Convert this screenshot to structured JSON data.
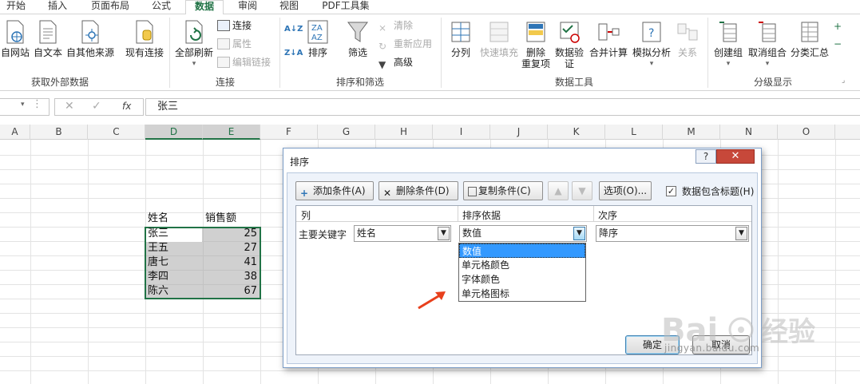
{
  "tabs": [
    "开始",
    "插入",
    "页面布局",
    "公式",
    "数据",
    "审阅",
    "视图",
    "PDF工具集"
  ],
  "active_tab": "数据",
  "ribbon": {
    "get_external": {
      "items": [
        "自网站",
        "自文本",
        "自其他来源",
        "现有连接"
      ],
      "label": "获取外部数据"
    },
    "connections": {
      "refresh_all": "全部刷新",
      "small": [
        "连接",
        "属性",
        "编辑链接"
      ],
      "label": "连接"
    },
    "sort_filter": {
      "sort": "排序",
      "filter": "筛选",
      "small": [
        "清除",
        "重新应用",
        "高级"
      ],
      "label": "排序和筛选"
    },
    "data_tools": {
      "items": [
        "分列",
        "快速填充",
        "删除",
        "重复项",
        "数据验",
        "证",
        "合并计算",
        "模拟分析",
        "关系"
      ],
      "label": "数据工具"
    },
    "outline": {
      "items": [
        "创建组",
        "取消组合",
        "分类汇总"
      ],
      "label": "分级显示"
    }
  },
  "formula_bar": {
    "fx": "fx",
    "content": "张三"
  },
  "columns": [
    "A",
    "B",
    "C",
    "D",
    "E",
    "F",
    "G",
    "H",
    "I",
    "J",
    "K",
    "L",
    "M",
    "N",
    "O"
  ],
  "sheet": {
    "header": [
      "姓名",
      "销售额"
    ],
    "rows": [
      [
        "张三",
        "25"
      ],
      [
        "王五",
        "27"
      ],
      [
        "唐七",
        "41"
      ],
      [
        "李四",
        "38"
      ],
      [
        "陈六",
        "67"
      ]
    ]
  },
  "dialog": {
    "title": "排序",
    "help": "?",
    "close": "✕",
    "add_level": "添加条件(A)",
    "delete_level": "删除条件(D)",
    "copy_level": "复制条件(C)",
    "options": "选项(O)...",
    "has_header": "数据包含标题(H)",
    "col_header": "列",
    "sort_on_header": "排序依据",
    "order_header": "次序",
    "row_label": "主要关键字",
    "column_value": "姓名",
    "sort_on_value": "数值",
    "order_value": "降序",
    "dropdown_options": [
      "数值",
      "单元格颜色",
      "字体颜色",
      "单元格图标"
    ],
    "ok": "确定",
    "cancel": "取消"
  },
  "watermark": {
    "text": "Bai 经验",
    "url": "jingyan.baidu.com"
  },
  "colors": {
    "accent": "#217346",
    "selection_fill": "#aaaaaa",
    "dropdown_highlight": "#3399ff",
    "close_button": "#c7483a",
    "arrow": "#e8401c"
  }
}
